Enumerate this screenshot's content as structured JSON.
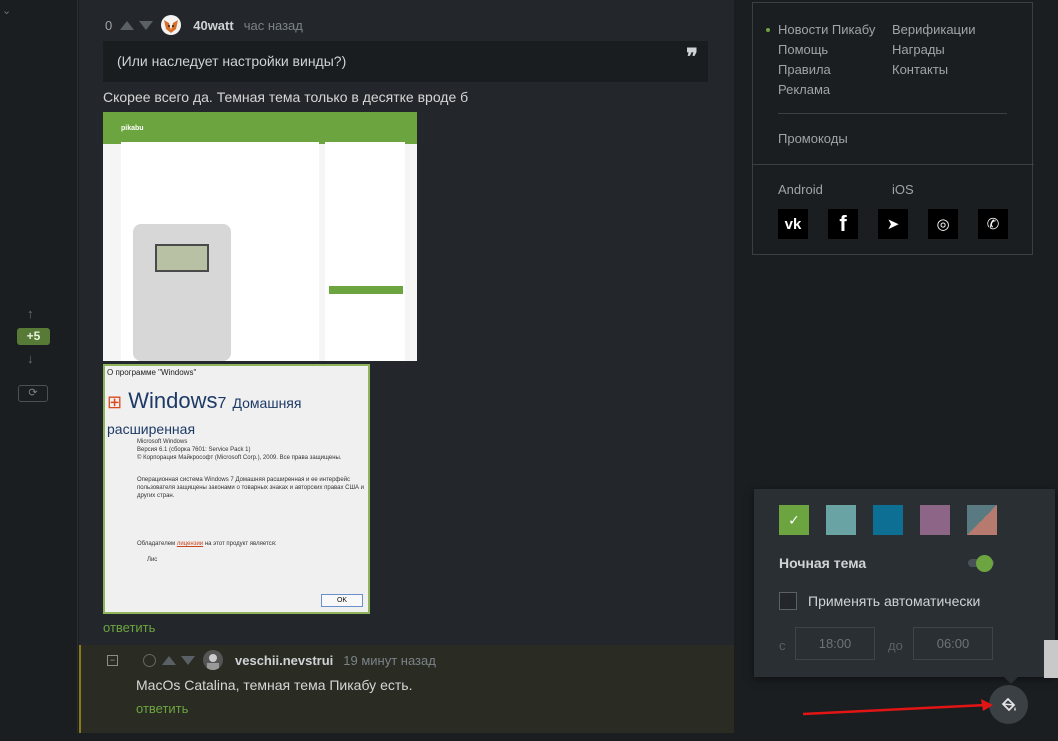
{
  "rail": {
    "score": "+5"
  },
  "comment": {
    "score": "0",
    "author": "40watt",
    "time": "час назад",
    "quote": "(Или наследует настройки винды?)",
    "text": "Скорее всего да. Темная тема только в десятке вроде б",
    "reply": "ответить"
  },
  "shot1": {
    "logo": "pikabu"
  },
  "shot2": {
    "dialog_title": "О программе \"Windows\"",
    "brand": "Windows",
    "version": "7",
    "edition": "Домашняя расширенная",
    "line1": "Microsoft Windows",
    "line2": "Версия 6.1 (сборка 7601: Service Pack 1)",
    "line3": "© Корпорация Майкрософт (Microsoft Corp.), 2009. Все права защищены.",
    "line4": "Операционная система Windows 7 Домашняя расширенная и ее интерфейс пользователя защищены законами о товарных знаках и авторских правах США и других стран.",
    "owner_prefix": "Обладателем ",
    "owner_link": "лицензии",
    "owner_suffix": " на этот продукт является:",
    "owner": "Лис",
    "ok": "OK"
  },
  "sub_comment": {
    "collapse": "−",
    "author": "veschii.nevstrui",
    "time": "19 минут назад",
    "text": "MacOs Catalina, темная тема Пикабу есть.",
    "reply": "ответить"
  },
  "footer_links": {
    "col1": [
      "Новости Пикабу",
      "Помощь",
      "Правила",
      "Реклама"
    ],
    "col2": [
      "Верификации",
      "Награды",
      "Контакты"
    ],
    "promo": "Промокоды",
    "android": "Android",
    "ios": "iOS"
  },
  "social": [
    {
      "icon": "vk-icon",
      "glyph": "vk"
    },
    {
      "icon": "facebook-icon",
      "glyph": "f"
    },
    {
      "icon": "telegram-icon",
      "glyph": "➤"
    },
    {
      "icon": "instagram-icon",
      "glyph": "◎"
    },
    {
      "icon": "viber-icon",
      "glyph": "✆"
    }
  ],
  "theme": {
    "swatches": [
      "#6ca540",
      "#6aa3a3",
      "#0e6f94",
      "#8c6587",
      "mixed"
    ],
    "selected_check": "✓",
    "night_label": "Ночная тема",
    "auto_label": "Применять автоматически",
    "from_label": "с",
    "from_value": "18:00",
    "to_label": "до",
    "to_value": "06:00"
  },
  "colors": {
    "accent": "#6ca540",
    "arrow": "#e31414"
  }
}
